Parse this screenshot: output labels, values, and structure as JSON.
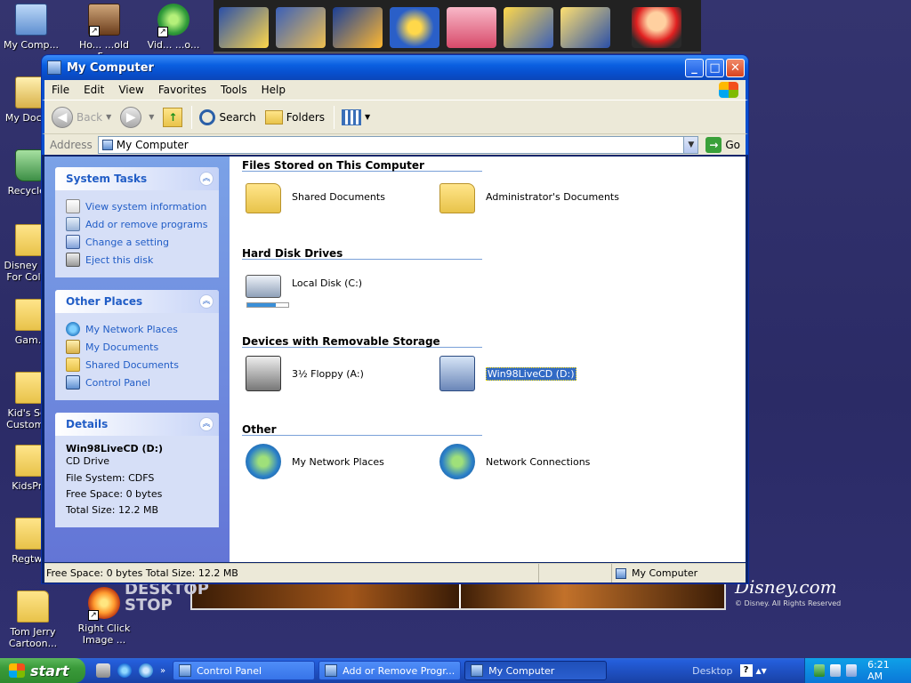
{
  "desktop": {
    "icons": [
      {
        "label": "My Comp...",
        "kind": "pc"
      },
      {
        "label": "My Docu...",
        "kind": "docs"
      },
      {
        "label": "Recycle...",
        "kind": "recycle"
      },
      {
        "label": "Disney Pi... For Colo...",
        "kind": "folder"
      },
      {
        "label": "Gam...",
        "kind": "folder"
      },
      {
        "label": "Kid's Sc... Customi...",
        "kind": "folder"
      },
      {
        "label": "KidsPr...",
        "kind": "folder"
      },
      {
        "label": "Regtw...",
        "kind": "folder"
      },
      {
        "label": "Tom Jerry Cartoon...",
        "kind": "folder"
      },
      {
        "label": "Right Click Image ...",
        "kind": "app3"
      },
      {
        "label": "Ho... ...old F...",
        "kind": "app1"
      },
      {
        "label": "Vid... ...o...",
        "kind": "app2"
      }
    ],
    "desktop_stop_text": "DESKTOP STOP",
    "disney_logo": "Disney.com",
    "disney_copyright": "© Disney. All Rights Reserved"
  },
  "window": {
    "title": "My Computer",
    "controls": {
      "minimize": "_",
      "maximize": "□",
      "close": "✕"
    },
    "menu": [
      "File",
      "Edit",
      "View",
      "Favorites",
      "Tools",
      "Help"
    ],
    "toolbar": {
      "back": "Back",
      "search": "Search",
      "folders": "Folders"
    },
    "address": {
      "label": "Address",
      "value": "My Computer",
      "go": "Go"
    },
    "left": {
      "system_tasks": {
        "title": "System Tasks",
        "items": [
          {
            "label": "View system information",
            "icon": "info"
          },
          {
            "label": "Add or remove programs",
            "icon": "addrem"
          },
          {
            "label": "Change a setting",
            "icon": "change"
          },
          {
            "label": "Eject this disk",
            "icon": "eject"
          }
        ]
      },
      "other_places": {
        "title": "Other Places",
        "items": [
          {
            "label": "My Network Places",
            "icon": "netplaces"
          },
          {
            "label": "My Documents",
            "icon": "mydocs"
          },
          {
            "label": "Shared Documents",
            "icon": "shareddocs"
          },
          {
            "label": "Control Panel",
            "icon": "cpanel"
          }
        ]
      },
      "details": {
        "title": "Details",
        "name": "Win98LiveCD (D:)",
        "lines": [
          "CD Drive",
          "File System: CDFS",
          "Free Space: 0 bytes",
          "Total Size: 12.2 MB"
        ]
      }
    },
    "groups": [
      {
        "title": "Files Stored on This Computer",
        "items": [
          {
            "label": "Shared Documents",
            "icon": "folder"
          },
          {
            "label": "Administrator's Documents",
            "icon": "folder"
          }
        ]
      },
      {
        "title": "Hard Disk Drives",
        "items": [
          {
            "label": "Local Disk (C:)",
            "icon": "disk",
            "usage": 0.7
          }
        ]
      },
      {
        "title": "Devices with Removable Storage",
        "items": [
          {
            "label": "3½ Floppy (A:)",
            "icon": "floppy"
          },
          {
            "label": "Win98LiveCD (D:)",
            "icon": "cd",
            "selected": true
          }
        ]
      },
      {
        "title": "Other",
        "items": [
          {
            "label": "My Network Places",
            "icon": "globe"
          },
          {
            "label": "Network Connections",
            "icon": "globe"
          }
        ]
      }
    ],
    "status": {
      "left": "Free Space: 0 bytes Total Size: 12.2 MB",
      "right": "My Computer"
    }
  },
  "taskbar": {
    "start": "start",
    "buttons": [
      {
        "label": "Control Panel",
        "active": false
      },
      {
        "label": "Add or Remove Progr...",
        "active": false
      },
      {
        "label": "My Computer",
        "active": true
      }
    ],
    "desktop_label": "Desktop",
    "clock": "6:21 AM"
  }
}
